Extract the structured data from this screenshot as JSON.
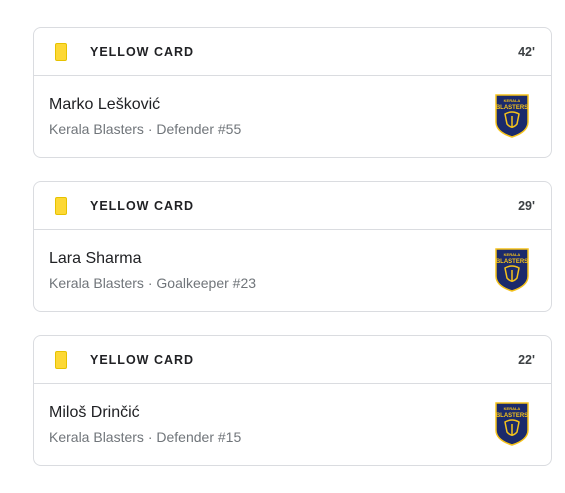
{
  "events": [
    {
      "type": "YELLOW CARD",
      "minute": "42'",
      "player": "Marko Lešković",
      "team": "Kerala Blasters",
      "detail": "Defender #55",
      "icon": "yellow-card-icon",
      "logo_text": [
        "KERALA",
        "BLASTERS"
      ]
    },
    {
      "type": "YELLOW CARD",
      "minute": "29'",
      "player": "Lara Sharma",
      "team": "Kerala Blasters",
      "detail": "Goalkeeper #23",
      "icon": "yellow-card-icon",
      "logo_text": [
        "KERALA",
        "BLASTERS"
      ]
    },
    {
      "type": "YELLOW CARD",
      "minute": "22'",
      "player": "Miloš Drinčić",
      "team": "Kerala Blasters",
      "detail": "Defender #15",
      "icon": "yellow-card-icon",
      "logo_text": [
        "KERALA",
        "BLASTERS"
      ]
    }
  ],
  "separator": " · ",
  "colors": {
    "card_yellow": "#fdd835",
    "logo_navy": "#1b2a6b",
    "logo_gold": "#f5c21b"
  }
}
